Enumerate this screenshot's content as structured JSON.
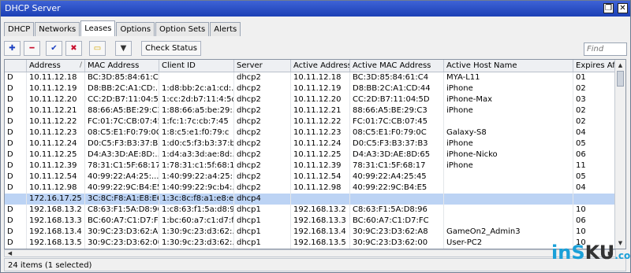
{
  "window": {
    "title": "DHCP Server",
    "restore_glyph": "❐",
    "close_glyph": "✕"
  },
  "tabs": [
    "DHCP",
    "Networks",
    "Leases",
    "Options",
    "Option Sets",
    "Alerts"
  ],
  "active_tab": "Leases",
  "toolbar": {
    "add_glyph": "✚",
    "remove_glyph": "━",
    "enable_glyph": "✔",
    "disable_glyph": "✖",
    "comment_glyph": "▭",
    "filter_glyph": "▼",
    "check_status_label": "Check Status",
    "find_placeholder": "Find"
  },
  "table": {
    "columns": [
      "",
      "Address",
      "MAC Address",
      "Client ID",
      "Server",
      "Active Address",
      "Active MAC Address",
      "Active Host Name",
      "Expires After"
    ],
    "sort_indicator": "/",
    "rows": [
      {
        "flag": "D",
        "address": "10.11.12.18",
        "mac": "BC:3D:85:84:61:C4",
        "client_id": "",
        "server": "dhcp2",
        "active_address": "10.11.12.18",
        "active_mac": "BC:3D:85:84:61:C4",
        "host": "MYA-L11",
        "expires": "01"
      },
      {
        "flag": "D",
        "address": "10.11.12.19",
        "mac": "D8:BB:2C:A1:CD:...",
        "client_id": "1:d8:bb:2c:a1:cd:...",
        "server": "dhcp2",
        "active_address": "10.11.12.19",
        "active_mac": "D8:BB:2C:A1:CD:44",
        "host": "iPhone",
        "expires": "02"
      },
      {
        "flag": "D",
        "address": "10.11.12.20",
        "mac": "CC:2D:B7:11:04:5D",
        "client_id": "1:cc:2d:b7:11:4:5d",
        "server": "dhcp2",
        "active_address": "10.11.12.20",
        "active_mac": "CC:2D:B7:11:04:5D",
        "host": "iPhone-Max",
        "expires": "03"
      },
      {
        "flag": "D",
        "address": "10.11.12.21",
        "mac": "88:66:A5:BE:29:C3",
        "client_id": "1:88:66:a5:be:29:...",
        "server": "dhcp2",
        "active_address": "10.11.12.21",
        "active_mac": "88:66:A5:BE:29:C3",
        "host": "iPhone",
        "expires": "02"
      },
      {
        "flag": "D",
        "address": "10.11.12.22",
        "mac": "FC:01:7C:CB:07:45",
        "client_id": "1:fc:1:7c:cb:7:45",
        "server": "dhcp2",
        "active_address": "10.11.12.22",
        "active_mac": "FC:01:7C:CB:07:45",
        "host": "",
        "expires": "02"
      },
      {
        "flag": "D",
        "address": "10.11.12.23",
        "mac": "08:C5:E1:F0:79:0C",
        "client_id": "1:8:c5:e1:f0:79:c",
        "server": "dhcp2",
        "active_address": "10.11.12.23",
        "active_mac": "08:C5:E1:F0:79:0C",
        "host": "Galaxy-S8",
        "expires": "04"
      },
      {
        "flag": "D",
        "address": "10.11.12.24",
        "mac": "D0:C5:F3:B3:37:B3",
        "client_id": "1:d0:c5:f3:b3:37:b3",
        "server": "dhcp2",
        "active_address": "10.11.12.24",
        "active_mac": "D0:C5:F3:B3:37:B3",
        "host": "iPhone",
        "expires": "05"
      },
      {
        "flag": "D",
        "address": "10.11.12.25",
        "mac": "D4:A3:3D:AE:8D:...",
        "client_id": "1:d4:a3:3d:ae:8d:...",
        "server": "dhcp2",
        "active_address": "10.11.12.25",
        "active_mac": "D4:A3:3D:AE:8D:65",
        "host": "iPhone-Nicko",
        "expires": "06"
      },
      {
        "flag": "D",
        "address": "10.11.12.39",
        "mac": "78:31:C1:5F:68:17",
        "client_id": "1:78:31:c1:5f:68:17",
        "server": "dhcp2",
        "active_address": "10.11.12.39",
        "active_mac": "78:31:C1:5F:68:17",
        "host": "iPhone",
        "expires": "11"
      },
      {
        "flag": "D",
        "address": "10.11.12.54",
        "mac": "40:99:22:A4:25:...",
        "client_id": "1:40:99:22:a4:25:...",
        "server": "dhcp2",
        "active_address": "10.11.12.54",
        "active_mac": "40:99:22:A4:25:45",
        "host": "",
        "expires": "05"
      },
      {
        "flag": "D",
        "address": "10.11.12.98",
        "mac": "40:99:22:9C:B4:E5",
        "client_id": "1:40:99:22:9c:b4:...",
        "server": "dhcp2",
        "active_address": "10.11.12.98",
        "active_mac": "40:99:22:9C:B4:E5",
        "host": "",
        "expires": "04"
      },
      {
        "flag": "",
        "address": "172.16.17.25",
        "mac": "3C:8C:F8:A1:E8:E6",
        "client_id": "1:3c:8c:f8:a1:e8:e6",
        "server": "dhcp4",
        "active_address": "",
        "active_mac": "",
        "host": "",
        "expires": "",
        "selected": true
      },
      {
        "flag": "D",
        "address": "192.168.13.2",
        "mac": "C8:63:F1:5A:D8:96",
        "client_id": "1:c8:63:f1:5a:d8:96",
        "server": "dhcp1",
        "active_address": "192.168.13.2",
        "active_mac": "C8:63:F1:5A:D8:96",
        "host": "",
        "expires": "10"
      },
      {
        "flag": "D",
        "address": "192.168.13.3",
        "mac": "BC:60:A7:C1:D7:FC",
        "client_id": "1:bc:60:a7:c1:d7:fc",
        "server": "dhcp1",
        "active_address": "192.168.13.3",
        "active_mac": "BC:60:A7:C1:D7:FC",
        "host": "",
        "expires": "06"
      },
      {
        "flag": "D",
        "address": "192.168.13.4",
        "mac": "30:9C:23:D3:62:A8",
        "client_id": "1:30:9c:23:d3:62:...",
        "server": "dhcp1",
        "active_address": "192.168.13.4",
        "active_mac": "30:9C:23:D3:62:A8",
        "host": "GameOn2_Admin3",
        "expires": "10"
      },
      {
        "flag": "D",
        "address": "192.168.13.5",
        "mac": "30:9C:23:D3:62:00",
        "client_id": "1:30:9c:23:d3:62:...",
        "server": "dhcp1",
        "active_address": "192.168.13.5",
        "active_mac": "30:9C:23:D3:62:00",
        "host": "User-PC2",
        "expires": "10"
      }
    ]
  },
  "status": {
    "summary": "24 items (1 selected)"
  },
  "scroll": {
    "up": "▲",
    "down": "▼",
    "left": "◀",
    "right": "▶"
  },
  "watermark": {
    "part1": "inS",
    "part2": "KU",
    "part3": ".com"
  }
}
